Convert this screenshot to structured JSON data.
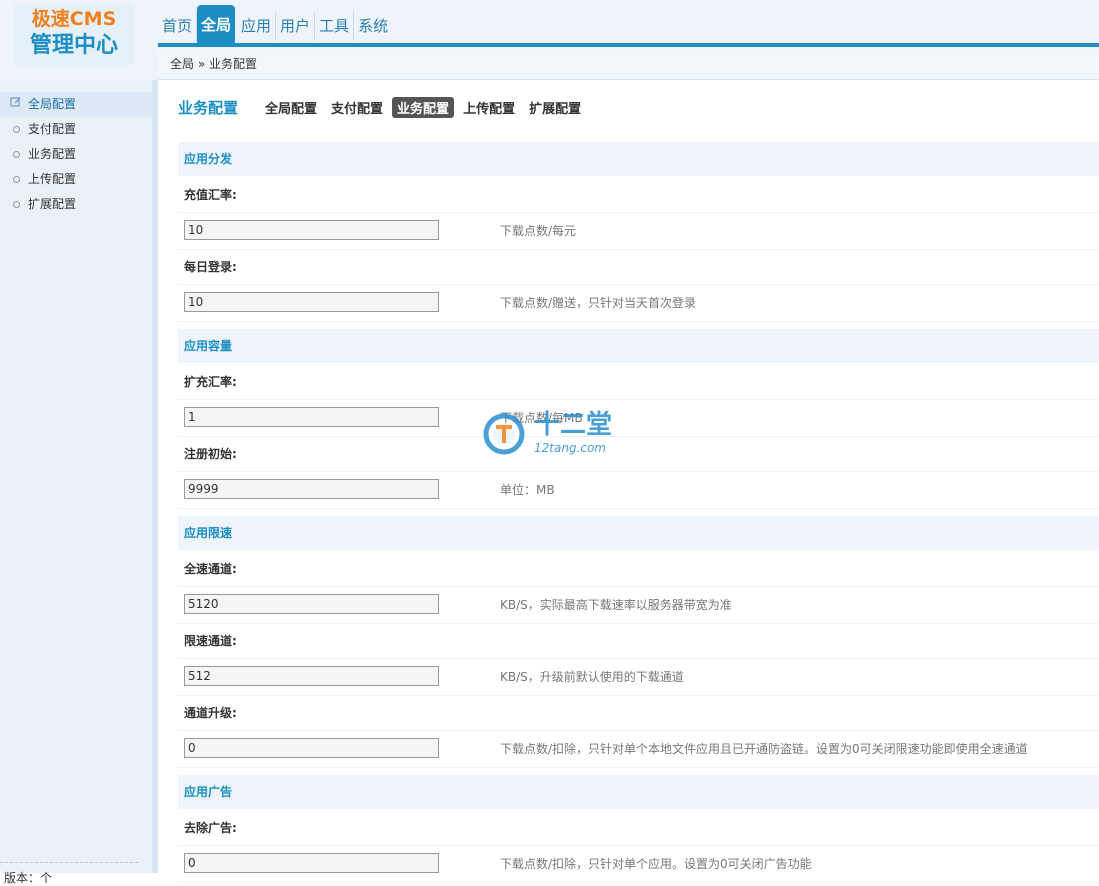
{
  "logo": {
    "line1": "极速CMS",
    "line2": "管理中心"
  },
  "topnav": [
    {
      "label": "首页",
      "active": false
    },
    {
      "label": "全局",
      "active": true
    },
    {
      "label": "应用",
      "active": false
    },
    {
      "label": "用户",
      "active": false
    },
    {
      "label": "工具",
      "active": false
    },
    {
      "label": "系统",
      "active": false
    }
  ],
  "breadcrumb": {
    "home": "全局",
    "separator": "»",
    "current": "业务配置"
  },
  "sidebar": {
    "items": [
      {
        "label": "全局配置",
        "icon": "edit-icon",
        "head": true
      },
      {
        "label": "支付配置"
      },
      {
        "label": "业务配置"
      },
      {
        "label": "上传配置"
      },
      {
        "label": "扩展配置"
      }
    ],
    "footer": "版本：个"
  },
  "subnav": {
    "title": "业务配置",
    "tabs": [
      {
        "label": "全局配置",
        "active": false
      },
      {
        "label": "支付配置",
        "active": false
      },
      {
        "label": "业务配置",
        "active": true
      },
      {
        "label": "上传配置",
        "active": false
      },
      {
        "label": "扩展配置",
        "active": false
      }
    ]
  },
  "sections": [
    {
      "title": "应用分发",
      "fields": [
        {
          "label": "充值汇率:",
          "value": "10",
          "hint": "下载点数/每元"
        },
        {
          "label": "每日登录:",
          "value": "10",
          "hint": "下载点数/赠送，只针对当天首次登录"
        }
      ]
    },
    {
      "title": "应用容量",
      "fields": [
        {
          "label": "扩充汇率:",
          "value": "1",
          "hint": "下载点数/每MB"
        },
        {
          "label": "注册初始:",
          "value": "9999",
          "hint": "单位：MB"
        }
      ]
    },
    {
      "title": "应用限速",
      "fields": [
        {
          "label": "全速通道:",
          "value": "5120",
          "hint": "KB/S，实际最高下载速率以服务器带宽为准"
        },
        {
          "label": "限速通道:",
          "value": "512",
          "hint": "KB/S，升级前默认使用的下载通道"
        },
        {
          "label": "通道升级:",
          "value": "0",
          "hint": "下载点数/扣除，只针对单个本地文件应用且已开通防盗链。设置为0可关闭限速功能即使用全速通道"
        }
      ]
    },
    {
      "title": "应用广告",
      "fields": [
        {
          "label": "去除广告:",
          "value": "0",
          "hint": "下载点数/扣除，只针对单个应用。设置为0可关闭广告功能"
        }
      ]
    }
  ],
  "watermark": {
    "text": "十二堂",
    "url": "12tang.com",
    "icon": "t-logo-icon"
  },
  "colors": {
    "accent": "#1d8dc3",
    "logo_orange": "#f07f1c",
    "section_bg": "#eef4fa"
  }
}
